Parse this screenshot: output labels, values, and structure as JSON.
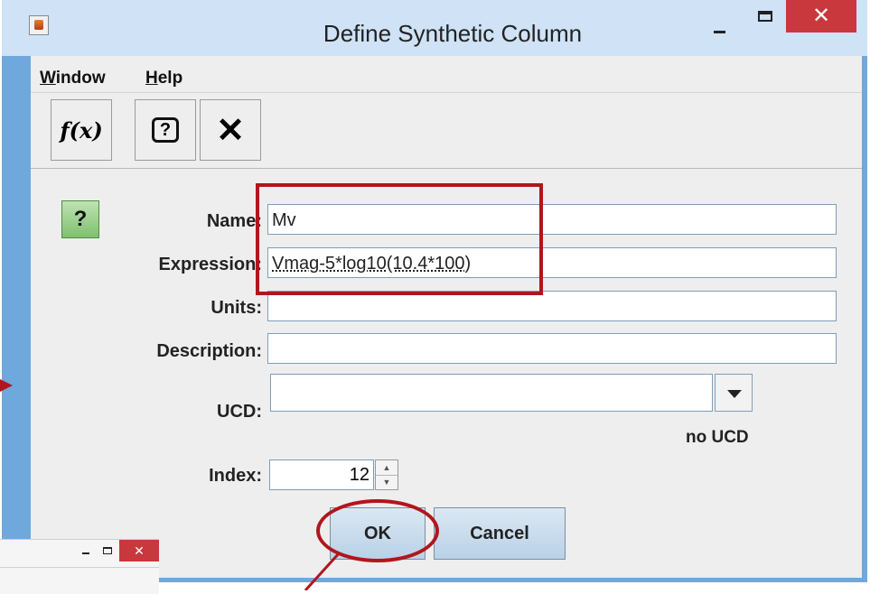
{
  "window": {
    "title": "Define Synthetic Column",
    "close_symbol": "✕"
  },
  "menu": {
    "items": [
      {
        "mnemonic": "W",
        "rest": "indow"
      },
      {
        "mnemonic": "H",
        "rest": "elp"
      }
    ]
  },
  "toolbar": {
    "function_icon_text": "f(x)",
    "help_icon_text": "?",
    "close_icon_text": "✕"
  },
  "form": {
    "help_button_text": "?",
    "name_label": "Name:",
    "name_value": "Mv",
    "expression_label": "Expression:",
    "expression_value": "Vmag-5*log10(10.4*100)",
    "units_label": "Units:",
    "units_value": "",
    "description_label": "Description:",
    "description_value": "",
    "ucd_label": "UCD:",
    "ucd_value": "",
    "ucd_status": "no UCD",
    "index_label": "Index:",
    "index_value": "12"
  },
  "buttons": {
    "ok": "OK",
    "cancel": "Cancel"
  },
  "background_window": {
    "close_symbol": "✕"
  },
  "colors": {
    "annotation": "#b0161c",
    "close_button": "#c9383c",
    "window_frame": "#cfe2f6"
  },
  "icons": [
    "app-icon",
    "function-icon",
    "help-icon",
    "close-icon",
    "dropdown-arrow-icon",
    "spinner-up-icon",
    "spinner-down-icon"
  ]
}
